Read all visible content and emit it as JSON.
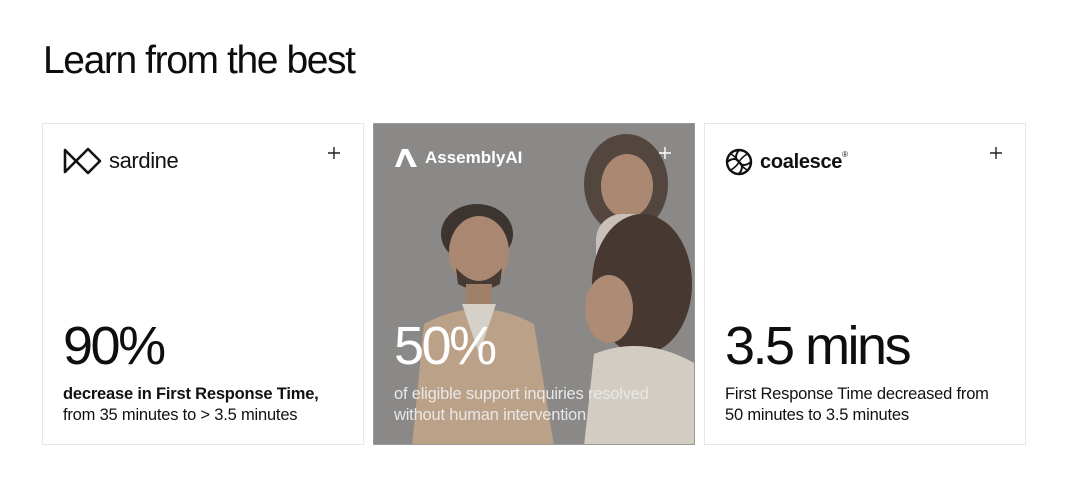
{
  "section": {
    "title": "Learn from the best"
  },
  "cards": [
    {
      "company": "sardine",
      "logo_icon": "sardine-logo-icon",
      "stat": "90%",
      "desc_bold": "decrease in First Response Time,",
      "desc_rest": " from 35 minutes to > 3.5 minutes",
      "expand_icon": "plus-icon"
    },
    {
      "company": "AssemblyAI",
      "logo_icon": "assemblyai-logo-icon",
      "stat": "50%",
      "desc": "of eligible support inquiries resolved without human intervention",
      "expand_icon": "plus-icon",
      "background": "photo-of-people-smiling"
    },
    {
      "company": "coalesce",
      "trademark": "®",
      "logo_icon": "coalesce-logo-icon",
      "stat": "3.5 mins",
      "desc": "First Response Time decreased from 50 minutes to 3.5 minutes",
      "expand_icon": "plus-icon"
    }
  ],
  "colors": {
    "text": "#111111",
    "border": "#e6e6e6",
    "photo_overlay": "#8c8a88"
  }
}
